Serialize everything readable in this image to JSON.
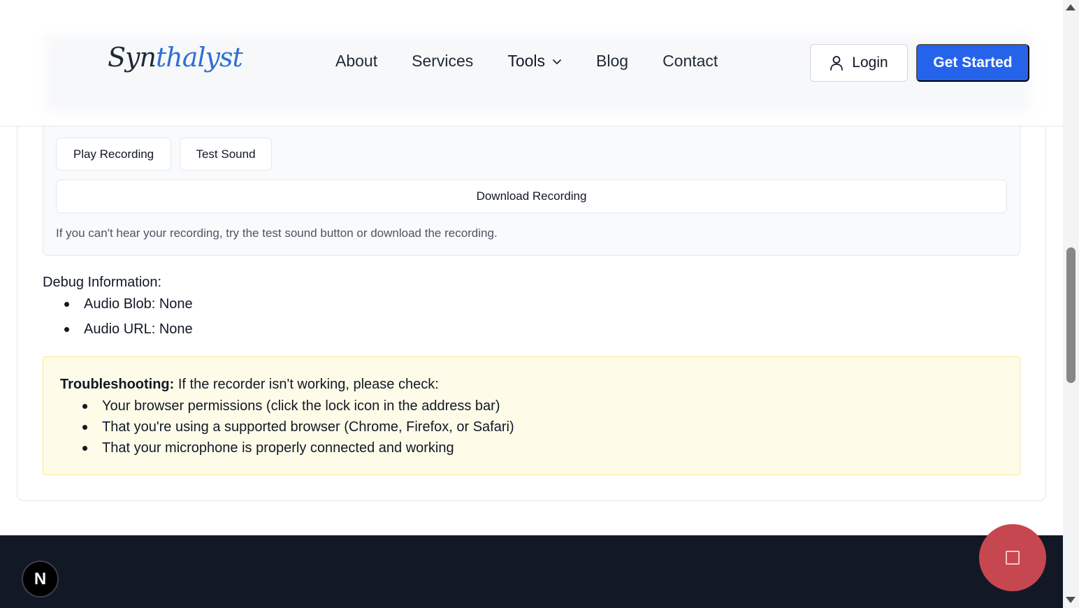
{
  "header": {
    "logo": {
      "part1": "Syn",
      "part2": "thalyst"
    },
    "nav": [
      {
        "label": "About"
      },
      {
        "label": "Services"
      },
      {
        "label": "Tools"
      },
      {
        "label": "Blog"
      },
      {
        "label": "Contact"
      }
    ],
    "login_label": "Login",
    "get_started_label": "Get Started"
  },
  "player": {
    "play_label": "Play Recording",
    "test_label": "Test Sound",
    "download_label": "Download Recording",
    "hint": "If you can't hear your recording, try the test sound button or download the recording."
  },
  "debug": {
    "title": "Debug Information:",
    "items": [
      "Audio Blob: None",
      "Audio URL: None"
    ]
  },
  "troubleshooting": {
    "label": "Troubleshooting:",
    "intro": " If the recorder isn't working, please check:",
    "items": [
      "Your browser permissions (click the lock icon in the address bar)",
      "That you're using a supported browser (Chrome, Firefox, or Safari)",
      "That your microphone is properly connected and working"
    ]
  },
  "badges": {
    "next": "N"
  },
  "colors": {
    "primary": "#2563eb",
    "record_fab": "#c6474f",
    "warning_bg": "#fefce8",
    "footer_bg": "#121826"
  },
  "icons": [
    "user-icon",
    "chevron-down-icon",
    "stop-icon",
    "next-logo-icon"
  ]
}
